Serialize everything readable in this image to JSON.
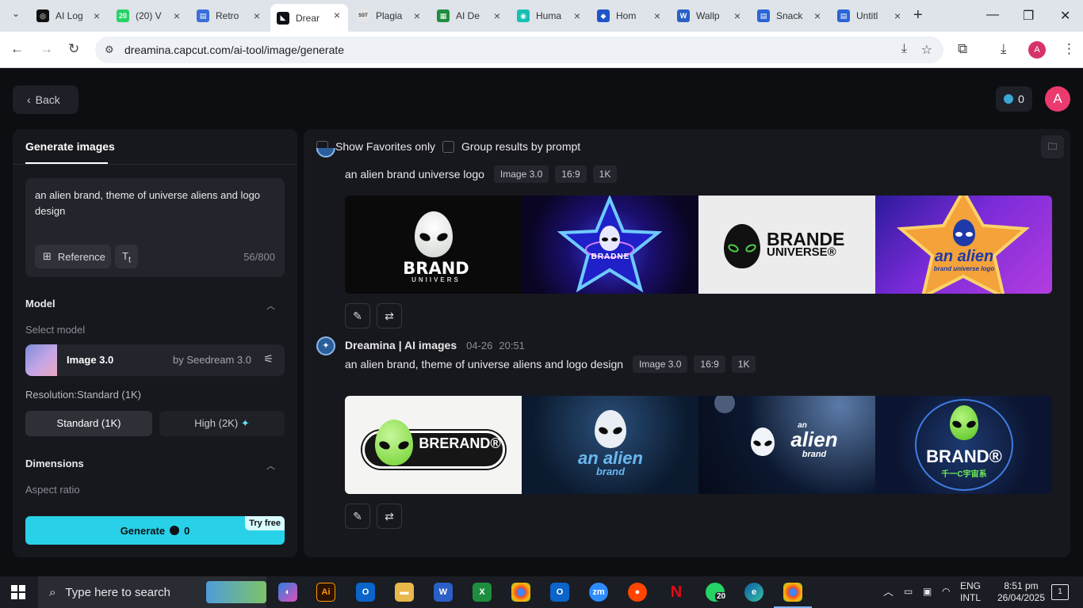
{
  "browser": {
    "tabs": [
      {
        "title": "AI Log",
        "favicon": "openai-icon",
        "color": "#111111",
        "glyph": "◎"
      },
      {
        "title": "(20) V",
        "favicon": "whatsapp-icon",
        "color": "#25d366",
        "glyph": "20"
      },
      {
        "title": "Retro",
        "favicon": "slides-icon",
        "color": "#3a6fd8",
        "glyph": "▤"
      },
      {
        "title": "Drear",
        "favicon": "dreamina-icon",
        "color": "#0e1216",
        "glyph": "◣",
        "active": true
      },
      {
        "title": "Plagia",
        "favicon": "sst-icon",
        "color": "#e6e6e6",
        "glyph": "SST"
      },
      {
        "title": "AI De",
        "favicon": "sheets-icon",
        "color": "#1e8e3e",
        "glyph": "▦"
      },
      {
        "title": "Huma",
        "favicon": "humanize-icon",
        "color": "#16c0b4",
        "glyph": "◉"
      },
      {
        "title": "Hom",
        "favicon": "site-icon",
        "color": "#1f55c9",
        "glyph": "◆"
      },
      {
        "title": "Wallp",
        "favicon": "word-icon",
        "color": "#2b5fc7",
        "glyph": "W"
      },
      {
        "title": "Snack",
        "favicon": "docs-icon",
        "color": "#2a66d8",
        "glyph": "▤"
      },
      {
        "title": "Untitl",
        "favicon": "docs-icon",
        "color": "#2a66d8",
        "glyph": "▤"
      }
    ],
    "url": "dreamina.capcut.com/ai-tool/image/generate",
    "profile_initial": "A"
  },
  "app": {
    "back_label": "Back",
    "credits": "0",
    "avatar_initial": "A"
  },
  "left_panel": {
    "tab_label": "Generate images",
    "prompt": "an alien brand, theme of universe aliens and logo design",
    "reference_label": "Reference",
    "char_count": "56/800",
    "model_section": "Model",
    "select_model_label": "Select model",
    "model_name": "Image 3.0",
    "model_by": "by Seedream 3.0",
    "resolution_label": "Resolution:Standard (1K)",
    "res_standard": "Standard (1K)",
    "res_high": "High (2K)",
    "dimensions_section": "Dimensions",
    "aspect_ratio_label": "Aspect ratio",
    "generate_label": "Generate",
    "generate_cost": "0",
    "try_free": "Try free"
  },
  "results": {
    "show_favorites": "Show Favorites only",
    "group_by_prompt": "Group results by prompt",
    "groups": [
      {
        "prompt": "an alien brand universe logo",
        "tags": [
          "Image 3.0",
          "16:9",
          "1K"
        ],
        "images": [
          {
            "alt": "alien-brand-dark",
            "text": "BRAND",
            "sub": "UNIIVERS"
          },
          {
            "alt": "neon-star-alien",
            "text": "BRADNE"
          },
          {
            "alt": "brande-universe-light",
            "text": "BRANDE",
            "sub": "UNIVERSE®"
          },
          {
            "alt": "an-alien-purple-star",
            "text": "an alien",
            "sub": "brand universe logo"
          }
        ]
      },
      {
        "author": "Dreamina | AI images",
        "date": "04-26",
        "time": "20:51",
        "prompt": "an alien brand, theme of universe aliens and logo design",
        "tags": [
          "Image 3.0",
          "16:9",
          "1K"
        ],
        "images": [
          {
            "alt": "brerand-sticker",
            "text": "BRERAND®"
          },
          {
            "alt": "an-alien-brand-crowd",
            "text": "an alien",
            "sub": "brand"
          },
          {
            "alt": "alien-brand-space",
            "text": "alien",
            "sub": "brand",
            "sup": "an"
          },
          {
            "alt": "brand-neon-planet",
            "text": "BRAND®",
            "sub": "千一C宇宙系"
          }
        ]
      }
    ]
  },
  "taskbar": {
    "search_placeholder": "Type here to search",
    "whatsapp_badge": "20",
    "lang": "ENG",
    "layout": "INTL",
    "time": "8:51 pm",
    "date": "26/04/2025",
    "notif_count": "1"
  }
}
